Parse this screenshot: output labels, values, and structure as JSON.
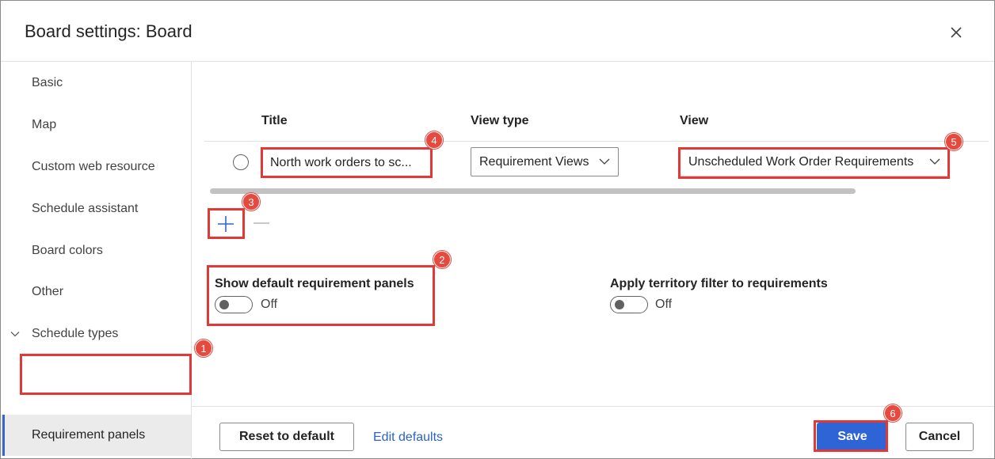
{
  "dialog": {
    "title": "Board settings: Board"
  },
  "sidebar": {
    "items": [
      {
        "label": "Basic"
      },
      {
        "label": "Map"
      },
      {
        "label": "Custom web resource"
      },
      {
        "label": "Schedule assistant"
      },
      {
        "label": "Board colors"
      },
      {
        "label": "Other"
      },
      {
        "label": "Schedule types"
      },
      {
        "label": "Requirement panels"
      }
    ],
    "selected": "Requirement panels"
  },
  "table": {
    "headers": {
      "title": "Title",
      "view_type": "View type",
      "view": "View"
    },
    "rows": [
      {
        "title": "North work orders to sc...",
        "view_type": "Requirement Views",
        "view": "Unscheduled Work Order Requirements"
      }
    ]
  },
  "toggles": {
    "default_panels": {
      "label": "Show default requirement panels",
      "state": "Off"
    },
    "territory": {
      "label": "Apply territory filter to requirements",
      "state": "Off"
    }
  },
  "footer": {
    "reset_label": "Reset to default",
    "edit_defaults_label": "Edit defaults",
    "save_label": "Save",
    "cancel_label": "Cancel"
  },
  "callouts": [
    "1",
    "2",
    "3",
    "4",
    "5",
    "6"
  ],
  "colors": {
    "accent": "#2f64d6",
    "callout": "#e23838",
    "link": "#2b62c7"
  }
}
